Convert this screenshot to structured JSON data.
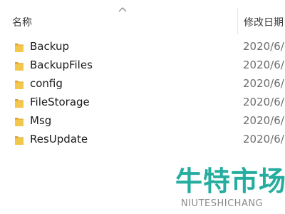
{
  "header": {
    "name_label": "名称",
    "date_label": "修改日期"
  },
  "files": [
    {
      "name": "Backup",
      "date": "2020/6/",
      "icon": "folder-icon"
    },
    {
      "name": "BackupFiles",
      "date": "2020/6/",
      "icon": "folder-icon"
    },
    {
      "name": "config",
      "date": "2020/6/",
      "icon": "folder-icon"
    },
    {
      "name": "FileStorage",
      "date": "2020/6/",
      "icon": "folder-icon"
    },
    {
      "name": "Msg",
      "date": "2020/6/",
      "icon": "folder-icon"
    },
    {
      "name": "ResUpdate",
      "date": "2020/6/",
      "icon": "folder-icon"
    }
  ],
  "watermark": {
    "text_cn": "牛特市场",
    "text_en": "NIUTESHICHANG"
  },
  "colors": {
    "folder": "#f3c74c",
    "folder_dark": "#dca52a",
    "watermark": "#1aa99a"
  }
}
